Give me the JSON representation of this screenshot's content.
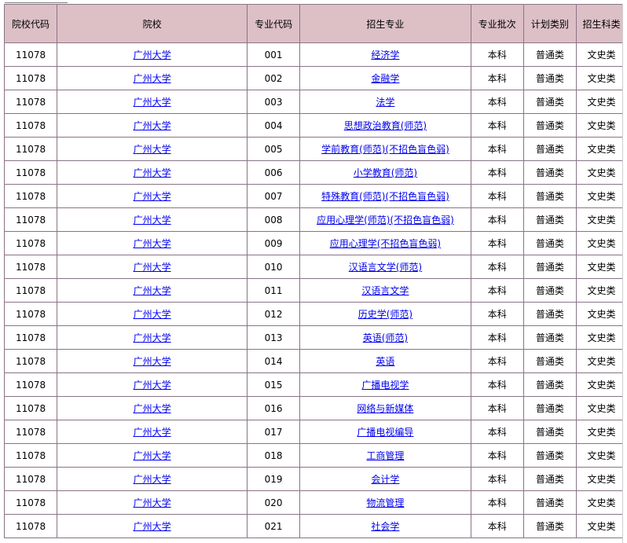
{
  "headers": {
    "school_code": "院校代码",
    "school": "院校",
    "major_code": "专业代码",
    "major": "招生专业",
    "batch": "专业批次",
    "plan_type": "计划类别",
    "subject_type": "招生科类"
  },
  "rows": [
    {
      "school_code": "11078",
      "school": "广州大学",
      "major_code": "001",
      "major": "经济学",
      "batch": "本科",
      "plan_type": "普通类",
      "subject_type": "文史类"
    },
    {
      "school_code": "11078",
      "school": "广州大学",
      "major_code": "002",
      "major": "金融学",
      "batch": "本科",
      "plan_type": "普通类",
      "subject_type": "文史类"
    },
    {
      "school_code": "11078",
      "school": "广州大学",
      "major_code": "003",
      "major": "法学",
      "batch": "本科",
      "plan_type": "普通类",
      "subject_type": "文史类"
    },
    {
      "school_code": "11078",
      "school": "广州大学",
      "major_code": "004",
      "major": "思想政治教育(师范)",
      "batch": "本科",
      "plan_type": "普通类",
      "subject_type": "文史类"
    },
    {
      "school_code": "11078",
      "school": "广州大学",
      "major_code": "005",
      "major": "学前教育(师范)(不招色盲色弱)",
      "batch": "本科",
      "plan_type": "普通类",
      "subject_type": "文史类"
    },
    {
      "school_code": "11078",
      "school": "广州大学",
      "major_code": "006",
      "major": "小学教育(师范)",
      "batch": "本科",
      "plan_type": "普通类",
      "subject_type": "文史类"
    },
    {
      "school_code": "11078",
      "school": "广州大学",
      "major_code": "007",
      "major": "特殊教育(师范)(不招色盲色弱)",
      "batch": "本科",
      "plan_type": "普通类",
      "subject_type": "文史类"
    },
    {
      "school_code": "11078",
      "school": "广州大学",
      "major_code": "008",
      "major": "应用心理学(师范)(不招色盲色弱)",
      "batch": "本科",
      "plan_type": "普通类",
      "subject_type": "文史类"
    },
    {
      "school_code": "11078",
      "school": "广州大学",
      "major_code": "009",
      "major": "应用心理学(不招色盲色弱)",
      "batch": "本科",
      "plan_type": "普通类",
      "subject_type": "文史类"
    },
    {
      "school_code": "11078",
      "school": "广州大学",
      "major_code": "010",
      "major": "汉语言文学(师范)",
      "batch": "本科",
      "plan_type": "普通类",
      "subject_type": "文史类"
    },
    {
      "school_code": "11078",
      "school": "广州大学",
      "major_code": "011",
      "major": "汉语言文学",
      "batch": "本科",
      "plan_type": "普通类",
      "subject_type": "文史类"
    },
    {
      "school_code": "11078",
      "school": "广州大学",
      "major_code": "012",
      "major": "历史学(师范)",
      "batch": "本科",
      "plan_type": "普通类",
      "subject_type": "文史类"
    },
    {
      "school_code": "11078",
      "school": "广州大学",
      "major_code": "013",
      "major": "英语(师范)",
      "batch": "本科",
      "plan_type": "普通类",
      "subject_type": "文史类"
    },
    {
      "school_code": "11078",
      "school": "广州大学",
      "major_code": "014",
      "major": "英语",
      "batch": "本科",
      "plan_type": "普通类",
      "subject_type": "文史类"
    },
    {
      "school_code": "11078",
      "school": "广州大学",
      "major_code": "015",
      "major": "广播电视学",
      "batch": "本科",
      "plan_type": "普通类",
      "subject_type": "文史类"
    },
    {
      "school_code": "11078",
      "school": "广州大学",
      "major_code": "016",
      "major": "网络与新媒体",
      "batch": "本科",
      "plan_type": "普通类",
      "subject_type": "文史类"
    },
    {
      "school_code": "11078",
      "school": "广州大学",
      "major_code": "017",
      "major": "广播电视编导",
      "batch": "本科",
      "plan_type": "普通类",
      "subject_type": "文史类"
    },
    {
      "school_code": "11078",
      "school": "广州大学",
      "major_code": "018",
      "major": "工商管理",
      "batch": "本科",
      "plan_type": "普通类",
      "subject_type": "文史类"
    },
    {
      "school_code": "11078",
      "school": "广州大学",
      "major_code": "019",
      "major": "会计学",
      "batch": "本科",
      "plan_type": "普通类",
      "subject_type": "文史类"
    },
    {
      "school_code": "11078",
      "school": "广州大学",
      "major_code": "020",
      "major": "物流管理",
      "batch": "本科",
      "plan_type": "普通类",
      "subject_type": "文史类"
    },
    {
      "school_code": "11078",
      "school": "广州大学",
      "major_code": "021",
      "major": "社会学",
      "batch": "本科",
      "plan_type": "普通类",
      "subject_type": "文史类"
    }
  ],
  "colors": {
    "header_bg": "#dcc0c6",
    "border": "#8a7386",
    "link": "#0000ee"
  }
}
